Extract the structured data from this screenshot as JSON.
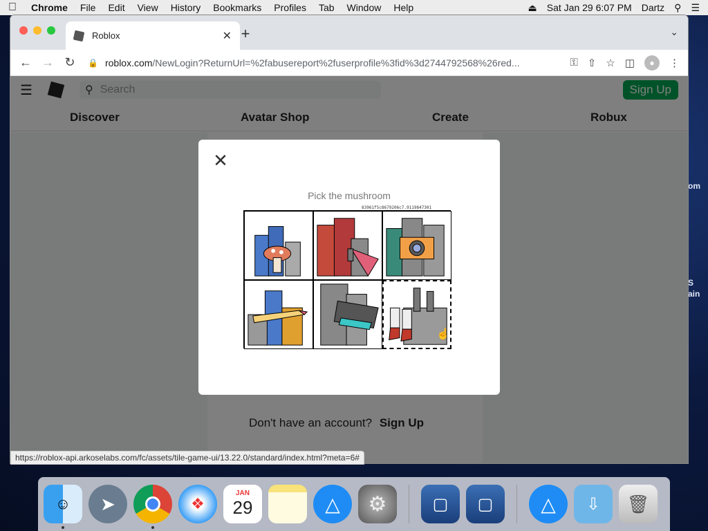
{
  "menubar": {
    "app": "Chrome",
    "items": [
      "File",
      "Edit",
      "View",
      "History",
      "Bookmarks",
      "Profiles",
      "Tab",
      "Window",
      "Help"
    ],
    "datetime": "Sat Jan 29  6:07 PM",
    "user": "Dartz"
  },
  "browser": {
    "tab_title": "Roblox",
    "url_host": "roblox.com",
    "url_path": "/NewLogin?ReturnUrl=%2fabusereport%2fuserprofile%3fid%3d2744792568%26red..."
  },
  "roblox": {
    "search_placeholder": "Search",
    "signup_label": "Sign Up",
    "nav": [
      "Discover",
      "Avatar Shop",
      "Create",
      "Robux"
    ],
    "dont_have": "Don't have an account?",
    "signup_link": "Sign Up"
  },
  "captcha": {
    "prompt": "Pick the mushroom",
    "hash": "83961f5c8679206c7.9119847301"
  },
  "statusbar": "https://roblox-api.arkoselabs.com/fc/assets/tile-game-ui/13.22.0/standard/index.html?meta=6#",
  "calendar": {
    "month": "JAN",
    "day": "29"
  },
  "wallpaper_text": [
    "om",
    "S",
    "ain"
  ]
}
